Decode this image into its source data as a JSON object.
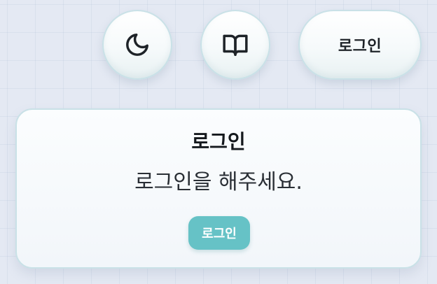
{
  "header": {
    "theme_toggle_icon": "moon-icon",
    "guide_icon": "book-open-icon",
    "login_label": "로그인"
  },
  "card": {
    "title": "로그인",
    "message": "로그인을 해주세요.",
    "button_label": "로그인"
  },
  "colors": {
    "background": "#e4e9f3",
    "accent": "#66c2c6",
    "border": "#c9e1e7",
    "text": "#15191d"
  }
}
